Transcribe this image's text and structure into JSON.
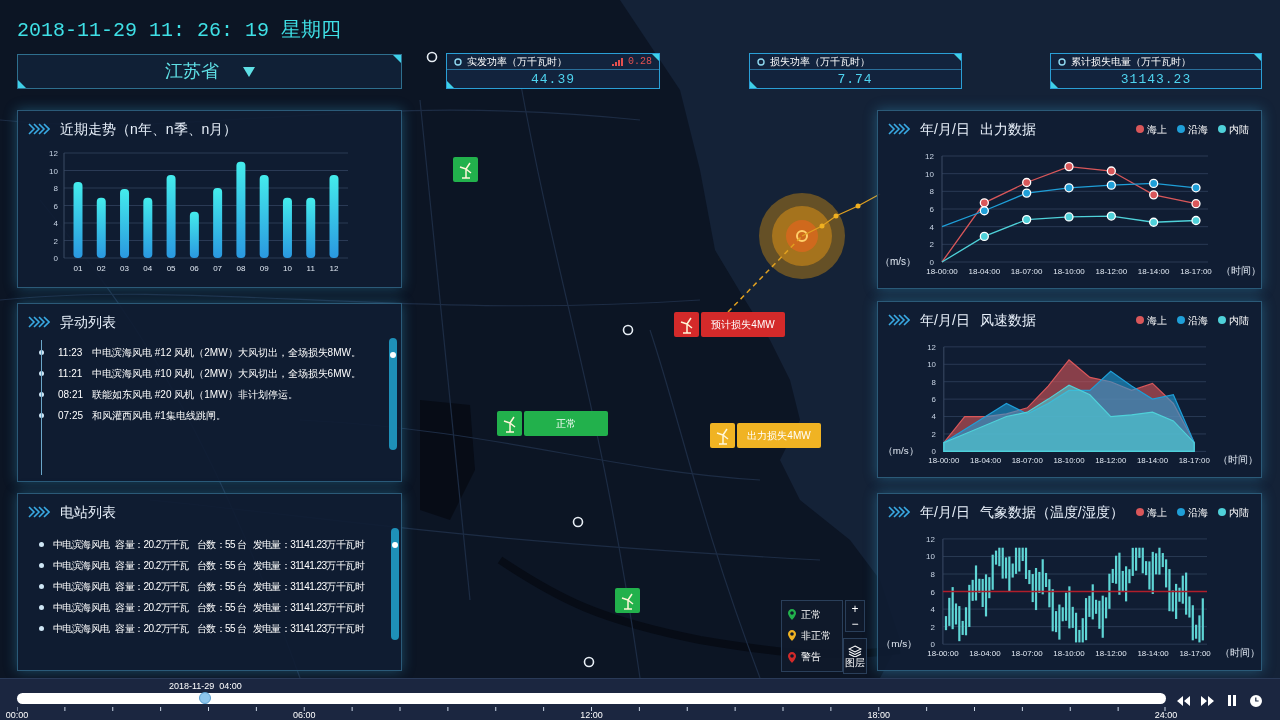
{
  "clock": "2018-11-29 11: 26: 19 星期四",
  "region_select": {
    "value": "江苏省"
  },
  "metrics": [
    {
      "label": "实发功率（万千瓦时）",
      "value": "44.39",
      "change": "0.28"
    },
    {
      "label": "损失功率（万千瓦时）",
      "value": "7.74"
    },
    {
      "label": "累计损失电量（万千瓦时）",
      "value": "31143.23"
    }
  ],
  "trend_panel": {
    "title": "近期走势（n年、n季、n月）",
    "chart_data": {
      "type": "bar",
      "grid": true,
      "categories": [
        "01",
        "02",
        "03",
        "04",
        "05",
        "06",
        "07",
        "08",
        "09",
        "10",
        "11",
        "12"
      ],
      "values": [
        8.7,
        6.9,
        7.9,
        6.9,
        9.5,
        5.3,
        8,
        11,
        9.5,
        6.9,
        6.9,
        9.5
      ],
      "ylim": [
        0,
        12
      ],
      "yticks": [
        0,
        2,
        4,
        6,
        8,
        10,
        12
      ]
    }
  },
  "events_panel": {
    "title": "异动列表",
    "items": [
      {
        "time": "11:23",
        "text": "中电滨海风电 #12 风机（2MW）大风切出，全场损失8MW。"
      },
      {
        "time": "11:21",
        "text": "中电滨海风电 #10 风机（2MW）大风切出，全场损失6MW。"
      },
      {
        "time": "08:21",
        "text": "联能如东风电 #20 风机（1MW）非计划停运。"
      },
      {
        "time": "07:25",
        "text": "和风灌西风电 #1集电线跳闸。"
      }
    ]
  },
  "stations_panel": {
    "title": "电站列表",
    "items": [
      {
        "name": "中电滨海风电",
        "capacity": "容量：20.2万千瓦",
        "units": "台数：55 台",
        "generation": "发电量：31141.23万千瓦时"
      },
      {
        "name": "中电滨海风电",
        "capacity": "容量：20.2万千瓦",
        "units": "台数：55 台",
        "generation": "发电量：31141.23万千瓦时"
      },
      {
        "name": "中电滨海风电",
        "capacity": "容量：20.2万千瓦",
        "units": "台数：55 台",
        "generation": "发电量：31141.23万千瓦时"
      },
      {
        "name": "中电滨海风电",
        "capacity": "容量：20.2万千瓦",
        "units": "台数：55 台",
        "generation": "发电量：31141.23万千瓦时"
      },
      {
        "name": "中电滨海风电",
        "capacity": "容量：20.2万千瓦",
        "units": "台数：55 台",
        "generation": "发电量：31141.23万千瓦时"
      }
    ]
  },
  "output_panel": {
    "title_date": "年/月/日",
    "title": "出力数据",
    "chart_data": {
      "type": "line",
      "grid": true,
      "xlabel": "（时间）",
      "ylabel": "（m/s）",
      "categories": [
        "18-00:00",
        "18-04:00",
        "18-07:00",
        "18-10:00",
        "18-12:00",
        "18-14:00",
        "18-17:00"
      ],
      "ylim": [
        0,
        12
      ],
      "yticks": [
        0,
        2,
        4,
        6,
        8,
        10,
        12
      ],
      "series": [
        {
          "name": "海上",
          "color": "#d9575a",
          "marker": true,
          "values": [
            0,
            6.7,
            9,
            10.8,
            10.3,
            7.6,
            6.6
          ]
        },
        {
          "name": "沿海",
          "color": "#1f9fd8",
          "marker": true,
          "values": [
            4,
            5.8,
            7.8,
            8.4,
            8.7,
            8.9,
            8.4
          ]
        },
        {
          "name": "内陆",
          "color": "#4fd1d9",
          "marker": true,
          "values": [
            0,
            2.9,
            4.8,
            5.1,
            5.2,
            4.5,
            4.7
          ]
        }
      ]
    }
  },
  "wind_panel": {
    "title_date": "年/月/日",
    "title": "风速数据",
    "chart_data": {
      "type": "area",
      "grid": true,
      "xlabel": "（时间）",
      "ylabel": "（m/s）",
      "categories": [
        "18-00:00",
        null,
        "18-04:00",
        null,
        "18-07:00",
        null,
        "18-10:00",
        null,
        "18-12:00",
        null,
        "18-14:00",
        null,
        "18-17:00"
      ],
      "ylim": [
        0,
        12
      ],
      "yticks": [
        0,
        2,
        4,
        6,
        8,
        10,
        12
      ],
      "series": [
        {
          "name": "海上",
          "color": "#d9575a",
          "values": [
            1,
            4,
            4,
            4.3,
            5,
            7.5,
            10.5,
            8.5,
            8,
            7,
            7.8,
            5.5,
            1
          ]
        },
        {
          "name": "沿海",
          "color": "#1f9fd8",
          "values": [
            1,
            2.5,
            4,
            5.5,
            4.3,
            5.5,
            7,
            7,
            9.2,
            7.5,
            6,
            6.5,
            1
          ]
        },
        {
          "name": "内陆",
          "color": "#4fd1d9",
          "values": [
            1,
            2,
            3,
            4,
            4.5,
            6,
            7.6,
            6.5,
            4,
            4.2,
            4.5,
            3.5,
            1
          ]
        }
      ]
    }
  },
  "weather_panel": {
    "title_date": "年/月/日",
    "title": "气象数据（温度/湿度）",
    "legend": [
      {
        "label": "海上",
        "color": "#d9575a"
      },
      {
        "label": "沿海",
        "color": "#1f9fd8"
      },
      {
        "label": "内陆",
        "color": "#4fd1d9"
      }
    ],
    "yticks": [
      "12",
      "10",
      "8",
      "6",
      "4",
      "2",
      "0"
    ],
    "xlabels": [
      "18-00:00",
      "18-04:00",
      "18-07:00",
      "18-10:00",
      "18-12:00",
      "18-14:00",
      "18-17:00"
    ],
    "ylabel": "（m/s）",
    "xlabel": "（时间）"
  },
  "map": {
    "markers": [
      {
        "color": "#22b14c"
      },
      {
        "color": "#d42a2a",
        "label": "预计损失4MW"
      },
      {
        "color": "#22b14c",
        "label": "正常"
      },
      {
        "color": "#f0b323",
        "label": "出力损失4MW"
      },
      {
        "color": "#22b14c"
      }
    ],
    "legend": [
      {
        "label": "正常",
        "color": "#22b14c"
      },
      {
        "label": "非正常",
        "color": "#f0b323"
      },
      {
        "label": "警告",
        "color": "#d42a2a"
      }
    ],
    "zoom_in": "+",
    "zoom_out": "−",
    "layers_button": "图层"
  },
  "timeline": {
    "current": "2018-11-29  04:00",
    "level": 0.164,
    "ticks": [
      "00:00",
      "06:00",
      "12:00",
      "18:00",
      "24:00"
    ]
  }
}
